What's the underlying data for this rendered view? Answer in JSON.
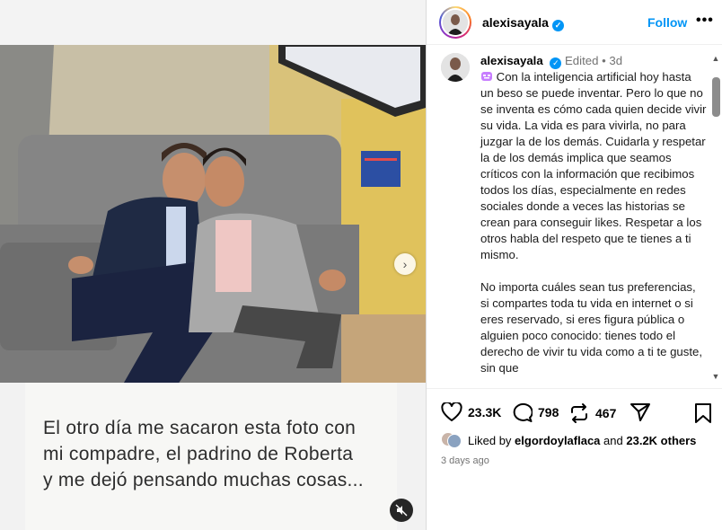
{
  "post": {
    "caption_overlay": [
      "El otro día me sacaron esta foto con",
      "mi compadre, el padrino de Roberta",
      "y me dejó pensando muchas cosas..."
    ]
  },
  "header": {
    "username": "alexisayala",
    "follow_label": "Follow",
    "more_label": "•••"
  },
  "comment": {
    "username": "alexisayala",
    "edited": "Edited",
    "separator": "•",
    "age": "3d",
    "emoji_icon": "mask-emoji-icon",
    "paragraph1": "Con la inteligencia artificial hoy hasta un beso se puede inventar. Pero lo que no se inventa es cómo cada quien decide vivir su vida. La vida es para vivirla, no para juzgar la de los demás. Cuidarla y respetar la de los demás implica que seamos críticos con la información que recibimos todos los días, especialmente en redes sociales donde a veces las historias se crean para conseguir likes. Respetar a los otros habla del respeto que te tienes a ti mismo.",
    "paragraph2": "No importa cuáles sean tus preferencias, si compartes toda tu vida en internet o si eres reservado, si eres figura pública o alguien poco conocido: tienes todo el derecho de vivir tu vida como a ti te guste, sin que"
  },
  "actions": {
    "likes": "23.3K",
    "comments": "798",
    "reposts": "467"
  },
  "liked_by": {
    "prefix": "Liked by",
    "user": "elgordoylaflaca",
    "and": "and",
    "others": "23.2K others"
  },
  "time_ago": "3 days ago",
  "colors": {
    "accent": "#0095f6",
    "muted": "#737373"
  }
}
